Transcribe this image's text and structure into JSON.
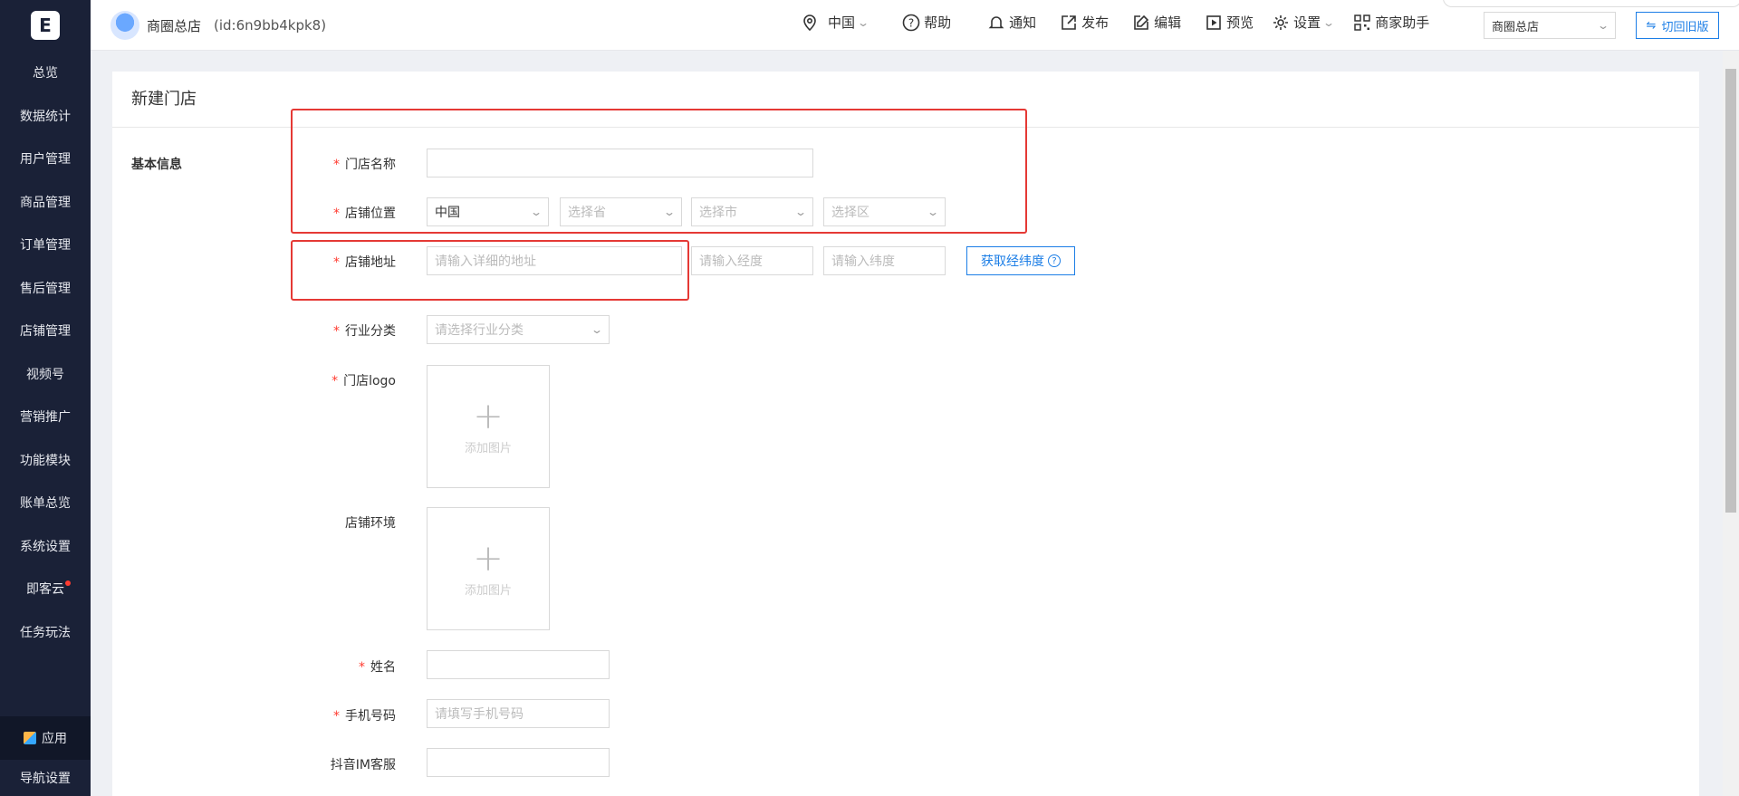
{
  "sidebar": {
    "logo": "E",
    "items": [
      {
        "label": "总览"
      },
      {
        "label": "数据统计"
      },
      {
        "label": "用户管理"
      },
      {
        "label": "商品管理"
      },
      {
        "label": "订单管理"
      },
      {
        "label": "售后管理"
      },
      {
        "label": "店铺管理"
      },
      {
        "label": "视频号"
      },
      {
        "label": "营销推广"
      },
      {
        "label": "功能模块"
      },
      {
        "label": "账单总览"
      },
      {
        "label": "系统设置"
      },
      {
        "label": "即客云"
      },
      {
        "label": "任务玩法"
      }
    ],
    "apps_label": "应用",
    "nav_settings_label": "导航设置"
  },
  "header": {
    "store_name": "商圈总店",
    "store_id": "(id:6n9bb4kpk8)",
    "region": "中国",
    "help": "帮助",
    "notify": "通知",
    "publish": "发布",
    "edit": "编辑",
    "preview": "预览",
    "settings": "设置",
    "assistant": "商家助手",
    "store_select": "商圈总店",
    "old_version": "切回旧版"
  },
  "form": {
    "title": "新建门店",
    "section": "基本信息",
    "store_name_label": "门店名称",
    "location_label": "店铺位置",
    "country_value": "中国",
    "province_placeholder": "选择省",
    "city_placeholder": "选择市",
    "district_placeholder": "选择区",
    "address_label": "店铺地址",
    "address_placeholder": "请输入详细的地址",
    "lng_placeholder": "请输入经度",
    "lat_placeholder": "请输入纬度",
    "get_coords": "获取经纬度",
    "industry_label": "行业分类",
    "industry_placeholder": "请选择行业分类",
    "logo_label": "门店logo",
    "add_image": "添加图片",
    "env_label": "店铺环境",
    "name_label": "姓名",
    "phone_label": "手机号码",
    "phone_placeholder": "请填写手机号码",
    "im_label": "抖音IM客服"
  },
  "colors": {
    "sidebar_bg": "#1a2137",
    "accent": "#1c7ee6",
    "required": "#ff3b30",
    "highlight": "#e53935"
  }
}
